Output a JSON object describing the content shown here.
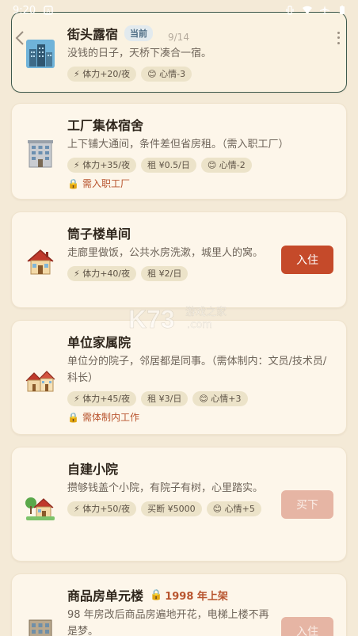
{
  "status_bar": {
    "time": "9:20"
  },
  "nav": {
    "page_indicator": "9/14"
  },
  "housing": [
    {
      "title": "街头露宿",
      "badge": "当前",
      "desc": "没钱的日子，天桥下凑合一宿。",
      "tags": [
        "⚡ 体力+20/夜",
        "😊 心情-3"
      ],
      "icon": "city-icon"
    },
    {
      "title": "工厂集体宿舍",
      "desc": "上下铺大通间，条件差但省房租。（需入职工厂）",
      "tags": [
        "⚡ 体力+35/夜",
        "租 ¥0.5/日",
        "😊 心情-2"
      ],
      "requirement": "需入职工厂",
      "icon": "office-building-icon"
    },
    {
      "title": "筒子楼单间",
      "desc": "走廊里做饭，公共水房洗漱，城里人的窝。",
      "tags": [
        "⚡ 体力+40/夜",
        "租 ¥2/日"
      ],
      "action": "入住",
      "icon": "house-icon"
    },
    {
      "title": "单位家属院",
      "desc": "单位分的院子，邻居都是同事。（需体制内：文员/技术员/科长）",
      "tags": [
        "⚡ 体力+45/夜",
        "租 ¥3/日",
        "😊 心情+3"
      ],
      "requirement": "需体制内工作",
      "icon": "houses-icon"
    },
    {
      "title": "自建小院",
      "desc": "攒够钱盖个小院，有院子有树，心里踏实。",
      "tags": [
        "⚡ 体力+50/夜",
        "买断 ¥5000",
        "😊 心情+5"
      ],
      "action": "买下",
      "icon": "house-with-garden-icon"
    },
    {
      "title": "商品房单元楼",
      "lock_note": "1998 年上架",
      "desc": "98 年房改后商品房遍地开花，电梯上楼不再是梦。",
      "action": "入住",
      "icon": "apartment-icon"
    }
  ],
  "watermark": {
    "logo": "K73",
    "sub": "游戏之家",
    "domain": ".com"
  }
}
